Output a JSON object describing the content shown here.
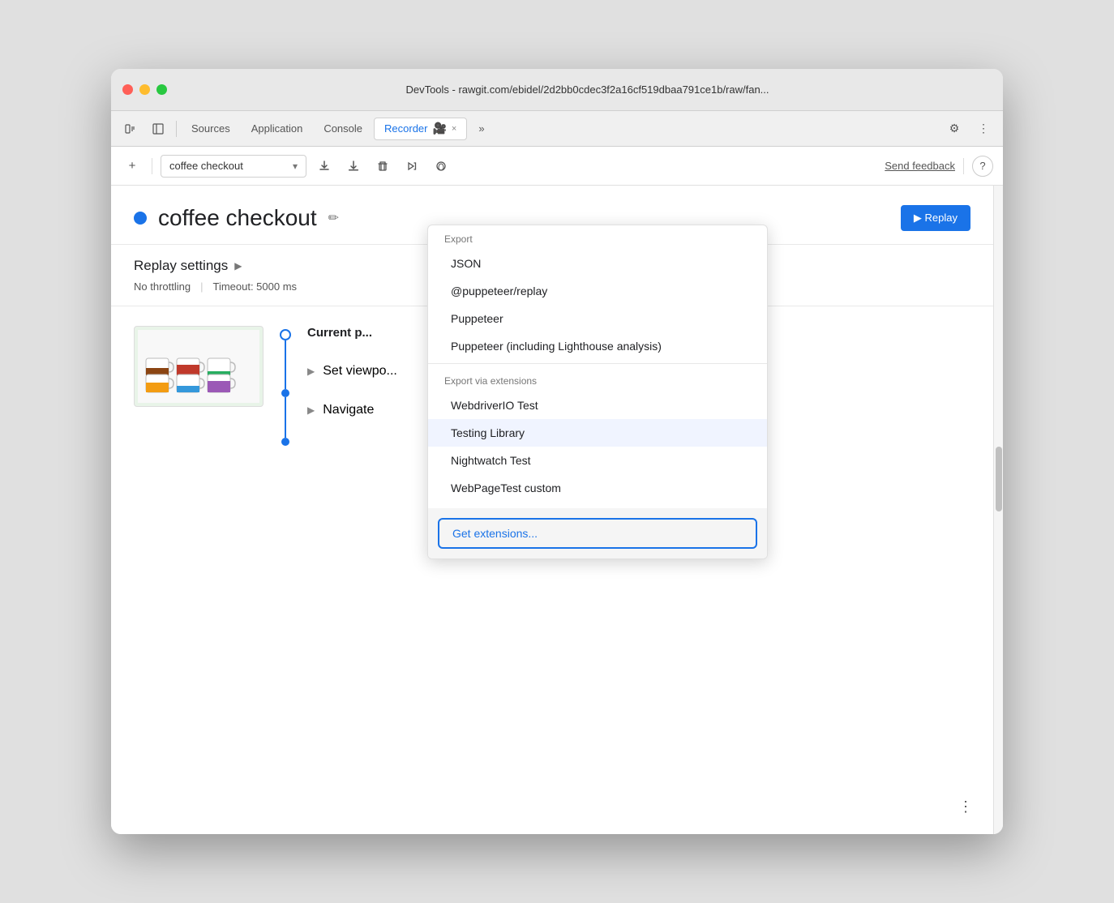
{
  "window": {
    "title": "DevTools - rawgit.com/ebidel/2d2bb0cdec3f2a16cf519dbaa791ce1b/raw/fan..."
  },
  "tabs": {
    "items": [
      {
        "label": "Sources",
        "active": false
      },
      {
        "label": "Application",
        "active": false
      },
      {
        "label": "Console",
        "active": false
      },
      {
        "label": "Recorder",
        "active": true
      },
      {
        "label": "»",
        "active": false
      }
    ],
    "close_label": "×"
  },
  "toolbar": {
    "add_label": "+",
    "recording_name": "coffee checkout",
    "send_feedback": "Send feedback",
    "help_icon": "?"
  },
  "recording": {
    "title": "coffee checkout",
    "edit_icon": "✏",
    "replay_label": "▶ Replay"
  },
  "replay_settings": {
    "title": "Replay settings",
    "arrow": "▶",
    "throttling": "No throttling",
    "timeout": "Timeout: 5000 ms"
  },
  "steps": {
    "current_page_label": "Current p",
    "set_viewport_label": "Set viewpo",
    "navigate_label": "Navigate",
    "three_dots": "⋮"
  },
  "dropdown": {
    "export_label": "Export",
    "export_items": [
      {
        "label": "JSON"
      },
      {
        "label": "@puppeteer/replay"
      },
      {
        "label": "Puppeteer"
      },
      {
        "label": "Puppeteer (including Lighthouse analysis)"
      }
    ],
    "via_extensions_label": "Export via extensions",
    "extension_items": [
      {
        "label": "WebdriverIO Test"
      },
      {
        "label": "Testing Library"
      },
      {
        "label": "Nightwatch Test"
      },
      {
        "label": "WebPageTest custom"
      }
    ],
    "get_extensions_label": "Get extensions..."
  },
  "colors": {
    "accent": "#1a73e8",
    "text_primary": "#202124",
    "text_secondary": "#555",
    "border": "#e0e0e0"
  }
}
